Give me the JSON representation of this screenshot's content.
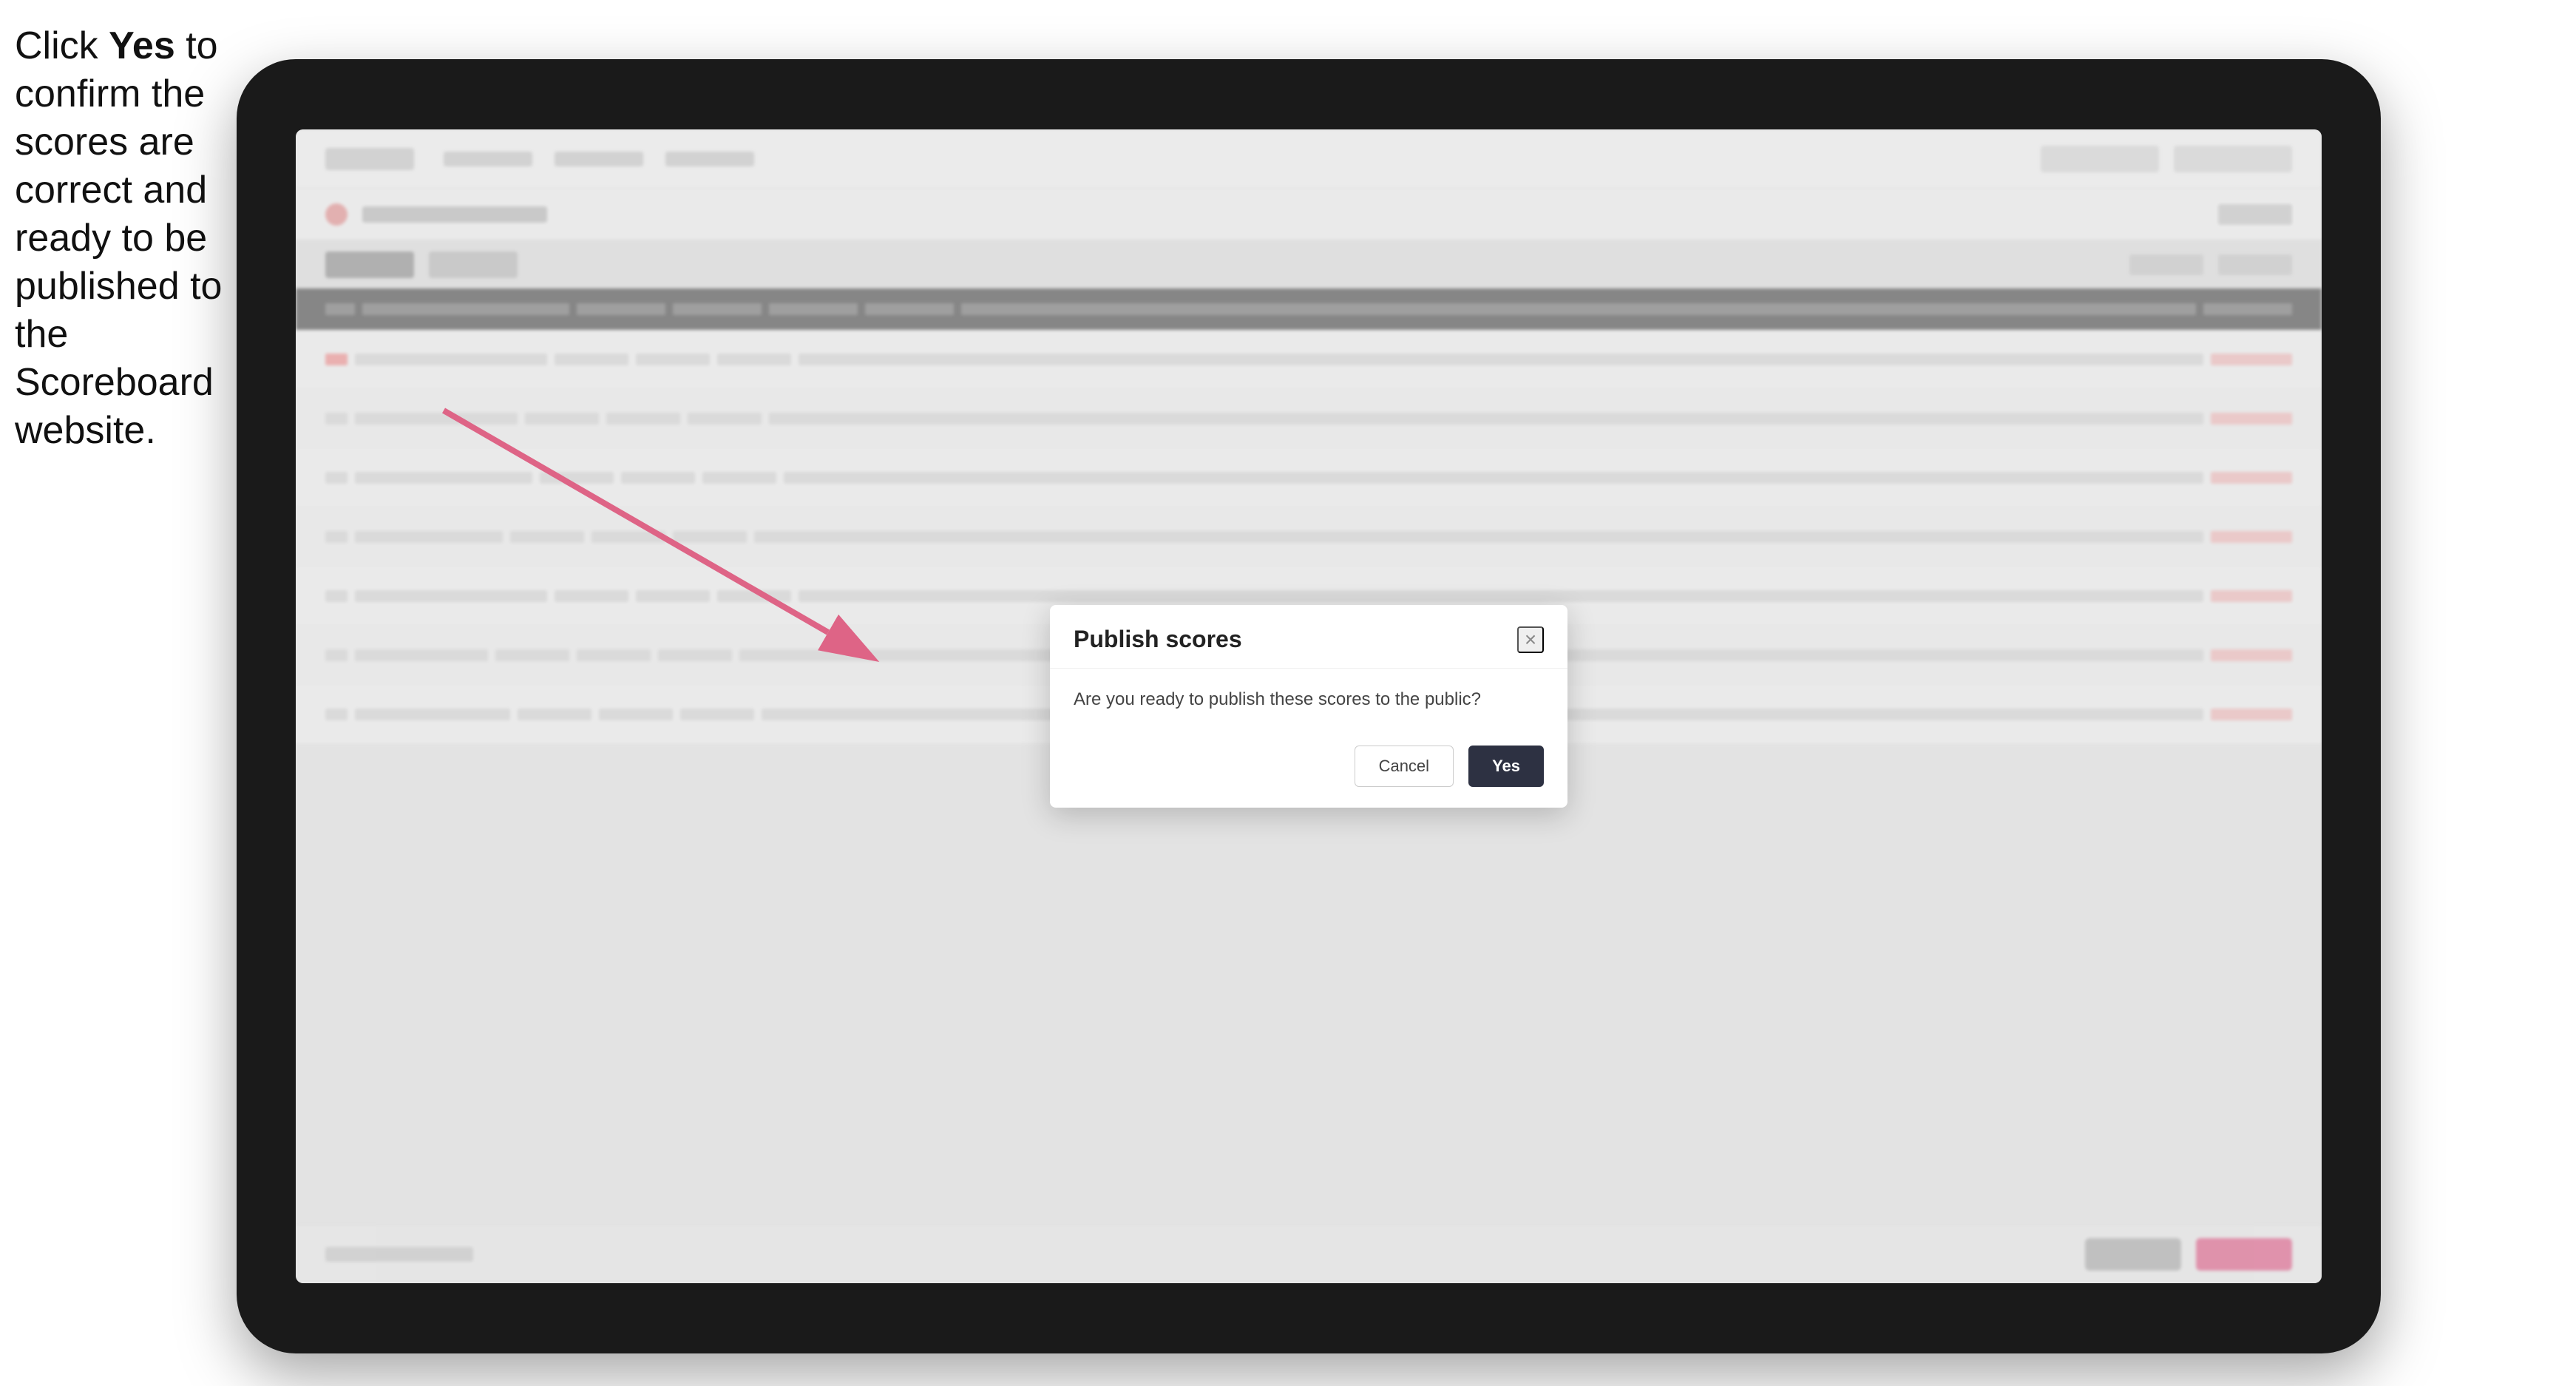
{
  "instruction": {
    "text_part1": "Click ",
    "bold": "Yes",
    "text_part2": " to confirm the scores are correct and ready to be published to the Scoreboard website."
  },
  "modal": {
    "title": "Publish scores",
    "message": "Are you ready to publish these scores to the public?",
    "close_label": "×",
    "cancel_label": "Cancel",
    "yes_label": "Yes"
  },
  "colors": {
    "yes_button_bg": "#2d3142",
    "yes_button_text": "#ffffff",
    "cancel_button_bg": "#ffffff"
  }
}
